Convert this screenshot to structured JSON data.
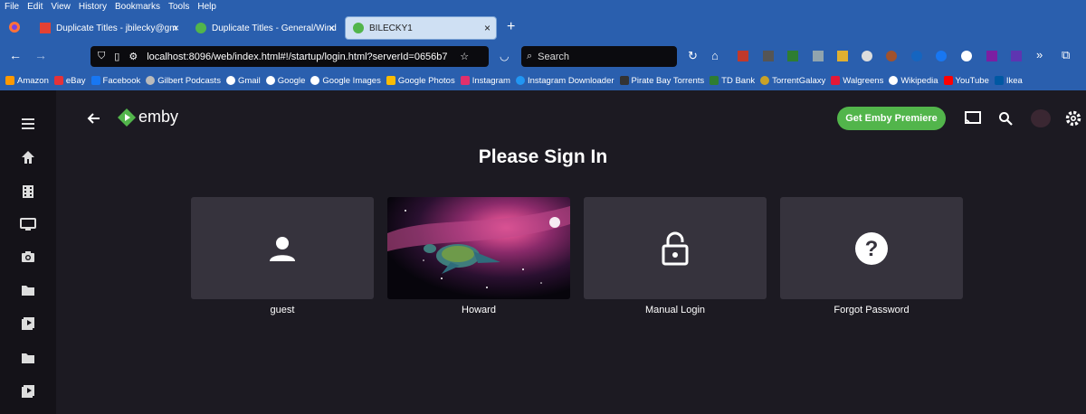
{
  "menubar": [
    "File",
    "Edit",
    "View",
    "History",
    "Bookmarks",
    "Tools",
    "Help"
  ],
  "tabs": [
    {
      "label": "Duplicate Titles - jbilecky@gm"
    },
    {
      "label": "Duplicate Titles - General/Wind"
    },
    {
      "label": "BILECKY1"
    }
  ],
  "url": "localhost:8096/web/index.html#!/startup/login.html?serverId=0656b7",
  "search_placeholder": "Search",
  "bookmarks": [
    "Amazon",
    "eBay",
    "Facebook",
    "Gilbert Podcasts",
    "Gmail",
    "Google",
    "Google Images",
    "Google Photos",
    "Instagram",
    "Instagram Downloader",
    "Pirate Bay Torrents",
    "TD Bank",
    "TorrentGalaxy",
    "Walgreens",
    "Wikipedia",
    "YouTube",
    "Ikea"
  ],
  "app": {
    "brand": "emby",
    "premiere_label": "Get Emby Premiere",
    "title": "Please Sign In",
    "cards": [
      {
        "label": "guest"
      },
      {
        "label": "Howard"
      },
      {
        "label": "Manual Login"
      },
      {
        "label": "Forgot Password"
      }
    ]
  },
  "colors": {
    "accent": "#52b54b",
    "chrome": "#2a5fae",
    "bg": "#1c1a22",
    "card": "#36333d"
  }
}
